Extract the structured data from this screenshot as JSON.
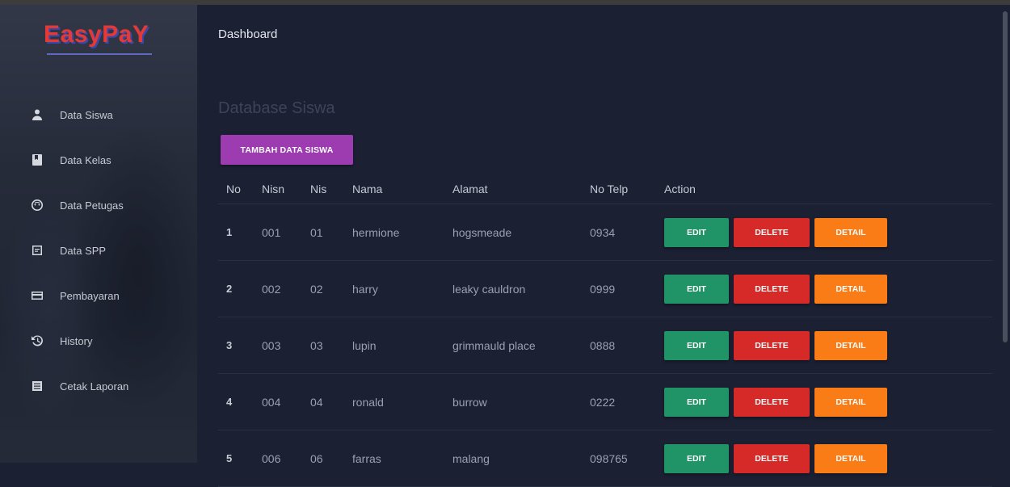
{
  "app": {
    "logo": "EasyPaY",
    "breadcrumb": "Dashboard"
  },
  "sidebar": {
    "items": [
      {
        "label": "Data Siswa",
        "icon": "person-icon"
      },
      {
        "label": "Data Kelas",
        "icon": "book-icon"
      },
      {
        "label": "Data Petugas",
        "icon": "face-icon"
      },
      {
        "label": "Data SPP",
        "icon": "document-icon"
      },
      {
        "label": "Pembayaran",
        "icon": "card-icon"
      },
      {
        "label": "History",
        "icon": "history-icon"
      },
      {
        "label": "Cetak Laporan",
        "icon": "list-icon"
      }
    ]
  },
  "main": {
    "title": "Database Siswa",
    "add_button": "TAMBAH DATA SISWA",
    "table": {
      "headers": [
        "No",
        "Nisn",
        "Nis",
        "Nama",
        "Alamat",
        "No Telp",
        "Action"
      ],
      "rows": [
        {
          "no": "1",
          "nisn": "001",
          "nis": "01",
          "nama": "hermione",
          "alamat": "hogsmeade",
          "telp": "0934"
        },
        {
          "no": "2",
          "nisn": "002",
          "nis": "02",
          "nama": "harry",
          "alamat": "leaky cauldron",
          "telp": "0999"
        },
        {
          "no": "3",
          "nisn": "003",
          "nis": "03",
          "nama": "lupin",
          "alamat": "grimmauld place",
          "telp": "0888"
        },
        {
          "no": "4",
          "nisn": "004",
          "nis": "04",
          "nama": "ronald",
          "alamat": "burrow",
          "telp": "0222"
        },
        {
          "no": "5",
          "nisn": "006",
          "nis": "06",
          "nama": "farras",
          "alamat": "malang",
          "telp": "098765"
        }
      ],
      "actions": {
        "edit": "EDIT",
        "delete": "DELETE",
        "detail": "DETAIL"
      }
    }
  },
  "colors": {
    "background": "#1b2033",
    "add_button": "#9c3cb0",
    "edit": "#219467",
    "delete": "#d52a28",
    "detail": "#f97c17"
  }
}
